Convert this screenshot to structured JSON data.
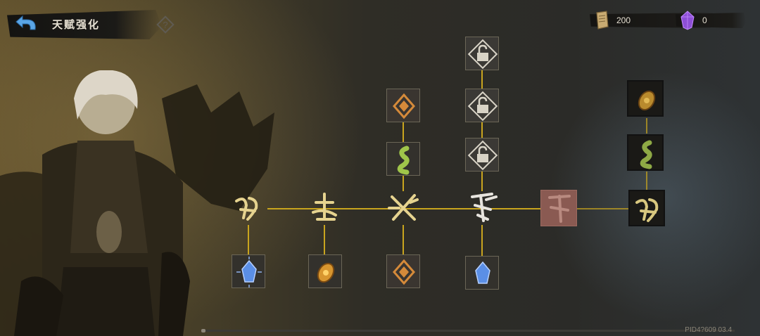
{
  "header": {
    "title": "天赋强化",
    "back_icon": "back-arrow-icon",
    "help_icon": "question-mark-icon"
  },
  "resources": [
    {
      "name": "scroll",
      "icon": "scroll-icon",
      "value": "200",
      "color": "#d6b57a"
    },
    {
      "name": "crystal",
      "icon": "purple-crystal-icon",
      "value": "0",
      "color": "#9a5ad8"
    }
  ],
  "colors": {
    "link": "#c9a51e",
    "gold_rune": "#e6d38f",
    "locked_rune_tile": "#8a5a52",
    "green_gem": "#9fc54a",
    "blue_gem": "#5b8fe6",
    "orange_gem": "#d8962f"
  },
  "talent_nodes": [
    {
      "id": "main-1",
      "icon": "gold-rune-icon",
      "state": "active"
    },
    {
      "id": "main-2",
      "icon": "gold-rune-icon",
      "state": "active"
    },
    {
      "id": "main-3",
      "icon": "gold-rune-icon",
      "state": "active"
    },
    {
      "id": "main-4",
      "icon": "silver-rune-icon",
      "state": "active"
    },
    {
      "id": "main-5",
      "icon": "red-rune-icon",
      "state": "locked"
    },
    {
      "id": "main-6",
      "icon": "gold-rune-icon",
      "state": "active"
    },
    {
      "id": "below-1",
      "icon": "blue-gem-icon",
      "state": "active"
    },
    {
      "id": "below-2",
      "icon": "orange-gem-icon",
      "state": "active"
    },
    {
      "id": "below-3",
      "icon": "orange-ornament-icon",
      "state": "active"
    },
    {
      "id": "below-4",
      "icon": "blue-gem-icon",
      "state": "active"
    },
    {
      "id": "above-3-a",
      "icon": "green-serpent-icon",
      "state": "active"
    },
    {
      "id": "above-3-b",
      "icon": "orange-ornament-icon",
      "state": "active"
    },
    {
      "id": "above-4-a",
      "icon": "unlock-icon",
      "state": "unlock"
    },
    {
      "id": "above-4-b",
      "icon": "unlock-icon",
      "state": "unlock"
    },
    {
      "id": "above-4-c",
      "icon": "unlock-icon",
      "state": "unlock"
    },
    {
      "id": "above-6-a",
      "icon": "green-serpent-icon",
      "state": "active"
    },
    {
      "id": "above-6-b",
      "icon": "orange-gem-icon",
      "state": "active"
    }
  ],
  "footer": {
    "pid": "PID4?609 03.4"
  },
  "scroll_position": 0
}
